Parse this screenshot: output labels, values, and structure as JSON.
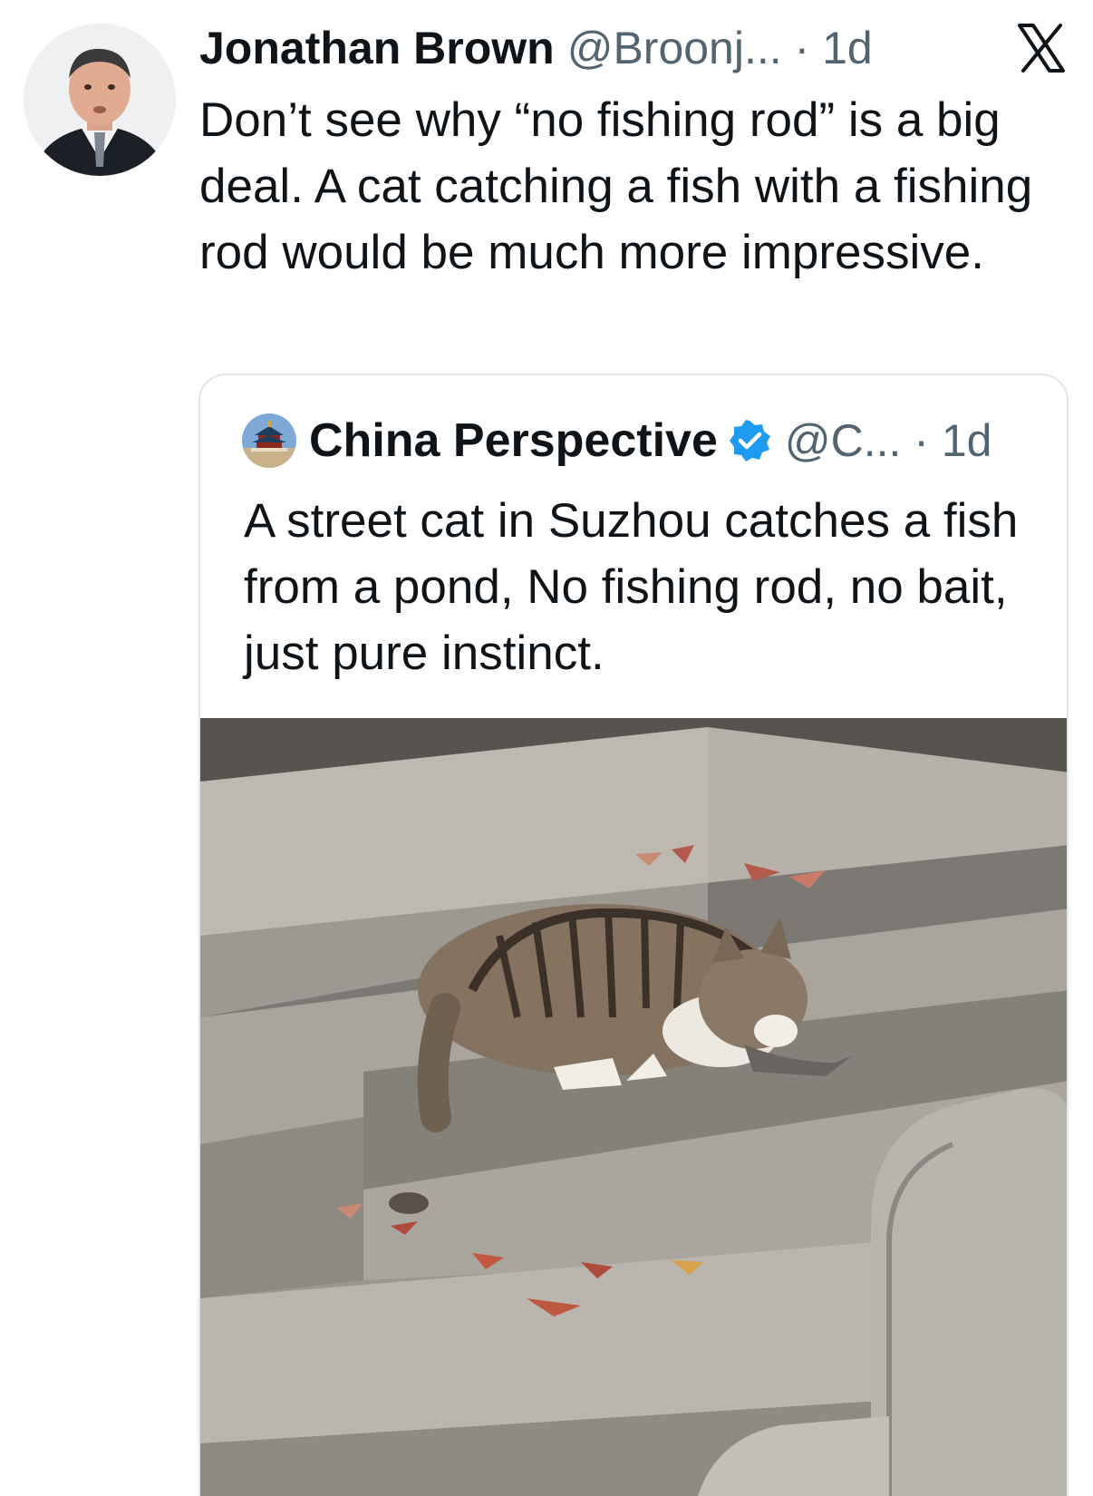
{
  "tweet": {
    "author_name": "Jonathan Brown",
    "handle_time": "@Broonj... · 1d",
    "text": "Don’t see why “no fishing rod” is a big deal. A cat catching a fish with a fishing rod would be much more impressive."
  },
  "quote": {
    "author_name": "China Perspective",
    "handle_time": "@C... · 1d",
    "text": "A street cat in Suzhou catches a fish from a pond, No fishing rod, no bait, just pure instinct.",
    "verified_color": "#1d9bf0"
  },
  "icons": {
    "brand": "x-logo-icon",
    "verified": "verified-badge-icon"
  }
}
